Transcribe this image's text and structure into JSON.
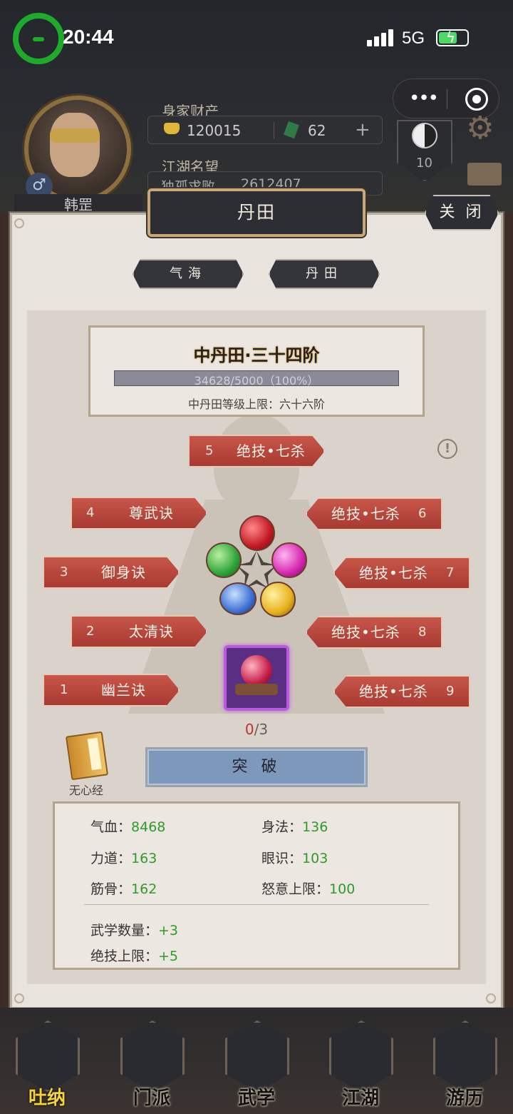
{
  "status_bar": {
    "time": "20:44",
    "network": "5G"
  },
  "header": {
    "wealth_label": "身家财产",
    "gold": "120015",
    "jade": "62",
    "fame_label": "江湖名望",
    "fame_title": "独孤求败",
    "fame_value": "2612407",
    "player_name": "韩罡",
    "taiji_level": "10"
  },
  "panel": {
    "title": "丹田",
    "close_label": "关 闭",
    "tabs": [
      {
        "label": "气海",
        "active": false
      },
      {
        "label": "丹田",
        "active": true
      }
    ],
    "stage_title": "中丹田·三十四阶",
    "progress_text": "34628/5000（100%）",
    "progress_fraction": 1.0,
    "limit_text": "中丹田等级上限：六十六阶"
  },
  "skills": [
    {
      "num": "5",
      "name": "绝技•七杀"
    },
    {
      "num": "4",
      "name": "尊武诀"
    },
    {
      "num": "6",
      "name": "绝技•七杀"
    },
    {
      "num": "3",
      "name": "御身诀"
    },
    {
      "num": "7",
      "name": "绝技•七杀"
    },
    {
      "num": "2",
      "name": "太清诀"
    },
    {
      "num": "8",
      "name": "绝技•七杀"
    },
    {
      "num": "1",
      "name": "幽兰诀"
    },
    {
      "num": "9",
      "name": "绝技•七杀"
    }
  ],
  "pill": {
    "current": "0",
    "total": "/3"
  },
  "book_label": "无心经",
  "break_label": "突 破",
  "stats": {
    "hp": {
      "label": "气血：",
      "value": "8468"
    },
    "agility": {
      "label": "身法：",
      "value": "136"
    },
    "strength": {
      "label": "力道：",
      "value": "163"
    },
    "insight": {
      "label": "眼识：",
      "value": "103"
    },
    "bone": {
      "label": "筋骨：",
      "value": "162"
    },
    "rage": {
      "label": "怒意上限：",
      "value": "100"
    },
    "martial_count": {
      "label": "武学数量：",
      "value": "+3"
    },
    "skill_limit": {
      "label": "绝技上限：",
      "value": "+5"
    }
  },
  "nav": [
    {
      "label": "吐纳",
      "active": true
    },
    {
      "label": "门派",
      "active": false
    },
    {
      "label": "武学",
      "active": false
    },
    {
      "label": "江湖",
      "active": false
    },
    {
      "label": "游历",
      "active": false
    }
  ]
}
